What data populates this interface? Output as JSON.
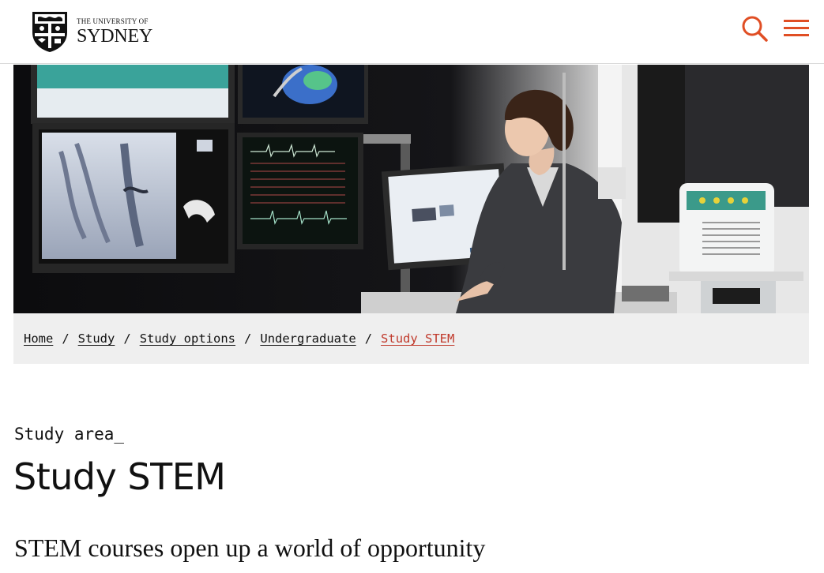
{
  "brand": {
    "university_line": "THE UNIVERSITY OF",
    "name_line": "SYDNEY",
    "accent": "#e04e24"
  },
  "header": {
    "search_icon": "search-icon",
    "menu_icon": "hamburger-menu-icon"
  },
  "hero": {
    "image": "Person at computer monitors in a medical imaging lab"
  },
  "breadcrumb": [
    {
      "label": "Home"
    },
    {
      "label": "Study"
    },
    {
      "label": "Study options"
    },
    {
      "label": "Undergraduate"
    },
    {
      "label": "Study STEM",
      "current": true
    }
  ],
  "breadcrumb_separator": "/",
  "content": {
    "eyebrow": "Study area_",
    "title": "Study STEM",
    "subheading": "STEM courses open up a world of opportunity"
  }
}
